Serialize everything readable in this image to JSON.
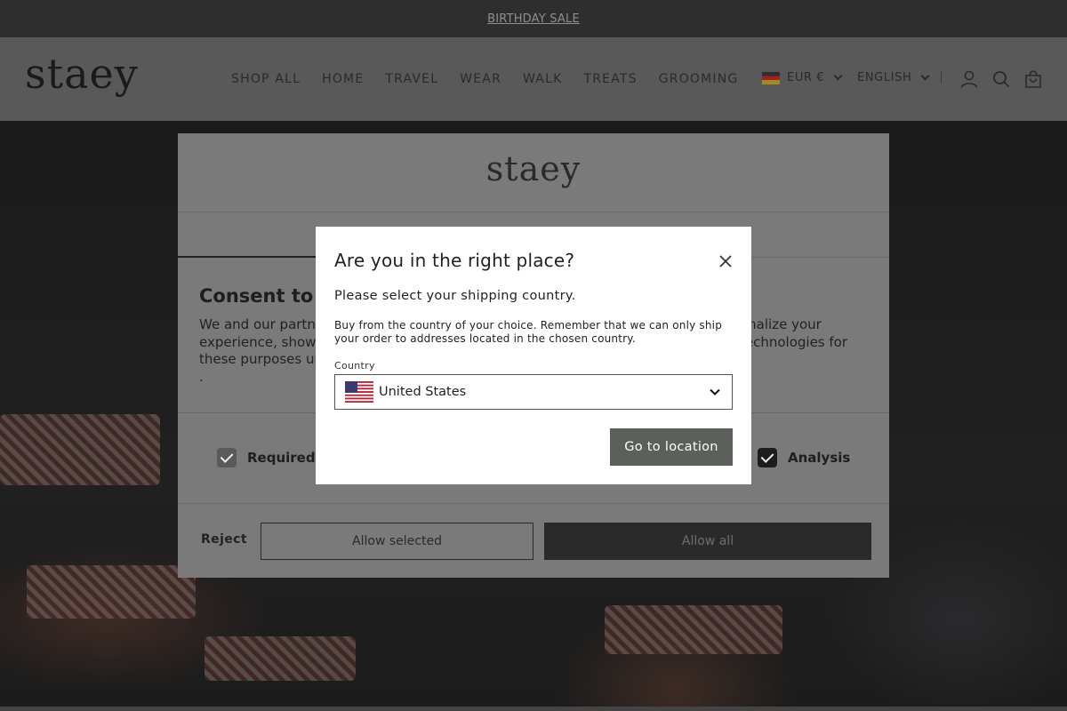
{
  "announcement": {
    "text": "BIRTHDAY SALE"
  },
  "header": {
    "logo": "staey",
    "nav": [
      "SHOP ALL",
      "HOME",
      "TRAVEL",
      "WEAR",
      "WALK",
      "TREATS",
      "GROOMING"
    ],
    "currency": "EUR €",
    "language": "ENGLISH",
    "icons": [
      "account-icon",
      "search-icon",
      "cart-icon"
    ]
  },
  "consent": {
    "logo": "staey",
    "title": "Consent to c",
    "text_left": "We and our partne\nexperience, show\nthese purposes ur\n.",
    "text_right": "onalize your\ntechnologies for",
    "options": [
      {
        "label": "Required",
        "checked": true
      },
      {
        "label": "Analysis",
        "checked": true
      }
    ],
    "reject_label": "Reject",
    "allow_selected_label": "Allow selected",
    "allow_all_label": "Allow all"
  },
  "country_modal": {
    "title": "Are you in the right place?",
    "subtitle": "Please select your shipping country.",
    "note": "Buy from the country of your choice. Remember that we can only ship your order to addresses located in the chosen country.",
    "field_label": "Country",
    "selected_country": "United States",
    "button_label": "Go to location"
  },
  "colors": {
    "announcement_bg": "#2e2e2e",
    "button_bg": "#5b605a"
  }
}
